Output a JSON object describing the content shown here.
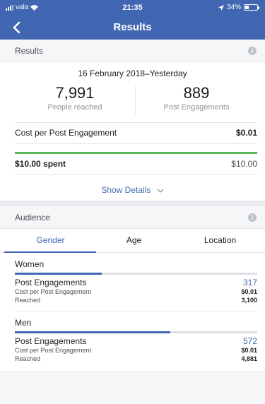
{
  "status_bar": {
    "carrier": "vala",
    "time": "21:35",
    "battery": "34%"
  },
  "nav": {
    "title": "Results"
  },
  "results": {
    "section_title": "Results",
    "date_range": "16 February 2018–Yesterday",
    "people_reached": {
      "value": "7,991",
      "label": "People reached"
    },
    "post_engagements": {
      "value": "889",
      "label": "Post Engagements"
    },
    "cost_label": "Cost per Post Engagement",
    "cost_value": "$0.01",
    "spent_label": "$10.00 spent",
    "budget": "$10.00",
    "spent_fraction": 1.0,
    "show_details": "Show Details"
  },
  "audience": {
    "section_title": "Audience",
    "tabs": [
      "Gender",
      "Age",
      "Location"
    ],
    "active_tab": "Gender",
    "groups": [
      {
        "name": "Women",
        "share_fraction": 0.36,
        "post_engagements_label": "Post Engagements",
        "post_engagements": "317",
        "cost_label": "Cost per Post Engagement",
        "cost": "$0.01",
        "reached_label": "Reached",
        "reached": "3,100"
      },
      {
        "name": "Men",
        "share_fraction": 0.64,
        "post_engagements_label": "Post Engagements",
        "post_engagements": "572",
        "cost_label": "Cost per Post Engagement",
        "cost": "$0.01",
        "reached_label": "Reached",
        "reached": "4,881"
      }
    ]
  },
  "colors": {
    "brand": "#4267b2",
    "progress": "#5eb95e"
  }
}
